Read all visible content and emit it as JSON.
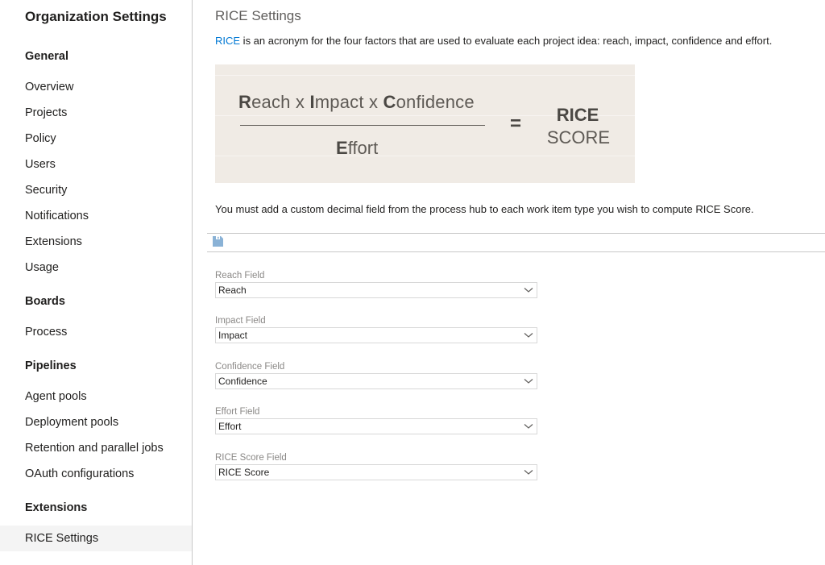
{
  "sidebar": {
    "title": "Organization Settings",
    "groups": [
      {
        "title": "General",
        "items": [
          {
            "label": "Overview"
          },
          {
            "label": "Projects"
          },
          {
            "label": "Policy"
          },
          {
            "label": "Users"
          },
          {
            "label": "Security"
          },
          {
            "label": "Notifications"
          },
          {
            "label": "Extensions"
          },
          {
            "label": "Usage"
          }
        ]
      },
      {
        "title": "Boards",
        "items": [
          {
            "label": "Process"
          }
        ]
      },
      {
        "title": "Pipelines",
        "items": [
          {
            "label": "Agent pools"
          },
          {
            "label": "Deployment pools"
          },
          {
            "label": "Retention and parallel jobs"
          },
          {
            "label": "OAuth configurations"
          }
        ]
      },
      {
        "title": "Extensions",
        "items": [
          {
            "label": "RICE Settings",
            "selected": true
          }
        ]
      }
    ]
  },
  "main": {
    "title": "RICE Settings",
    "intro_link": "RICE",
    "intro_text": " is an acronym for the four factors that are used to evaluate each project idea: reach, impact, confidence and effort.",
    "formula": {
      "reach_initial": "R",
      "reach_rest": "each",
      "times": " x ",
      "impact_initial": "I",
      "impact_rest": "mpact",
      "confidence_initial": "C",
      "confidence_rest": "onfidence",
      "effort_initial": "E",
      "effort_rest": "ffort",
      "equals": "=",
      "result_top": "RICE",
      "result_bottom": "SCORE"
    },
    "note": "You must add a custom decimal field from the process hub to each work item type you wish to compute RICE Score.",
    "toolbar": {
      "save_icon": "save-icon"
    },
    "fields": [
      {
        "label": "Reach Field",
        "value": "Reach"
      },
      {
        "label": "Impact Field",
        "value": "Impact"
      },
      {
        "label": "Confidence Field",
        "value": "Confidence"
      },
      {
        "label": "Effort Field",
        "value": "Effort"
      },
      {
        "label": "RICE Score Field",
        "value": "RICE Score"
      }
    ]
  },
  "colors": {
    "accent": "#0078d4",
    "save_icon": "#8ab2d6",
    "selected_nav_bg": "#f4f4f4",
    "formula_bg": "#f0ebe5"
  }
}
